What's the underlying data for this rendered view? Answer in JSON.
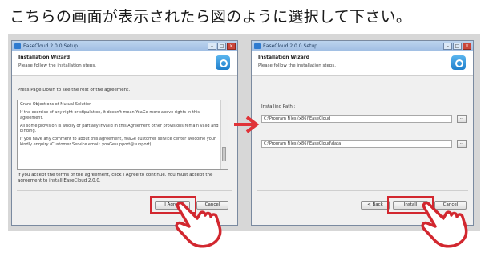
{
  "heading": "こちらの画面が表示されたら図のように選択して下さい。",
  "window1": {
    "title": "EaseCloud 2.0.0 Setup",
    "header_title": "Installation Wizard",
    "header_subtitle": "Please follow the installation steps.",
    "instruction": "Press Page Down to see the rest of the agreement.",
    "license_paragraphs": [
      "Grant Objections of Mutual Solution",
      "If the exercise of any right or stipulation, it doesn't mean YoaGe more above rights in this agreement.",
      "All some provision is wholly or partially invalid in this Agreement other provisions remain valid and binding.",
      "If you have any comment to about this agreement, YoaGe customer service center welcome your kindly enquiry (Customer Service email: yoaGesupport@support)"
    ],
    "accept_text": "If you accept the terms of the agreement, click I Agree to continue. You must accept the agreement to install EaseCloud 2.0.0.",
    "agree_button": "I Agree",
    "cancel_button": "Cancel"
  },
  "window2": {
    "title": "EaseCloud 2.0.0 Setup",
    "header_title": "Installation Wizard",
    "header_subtitle": "Please follow the installation steps.",
    "path_label": "Installing Path :",
    "path1": "C:\\Program Files (x86)\\EaseCloud",
    "path2": "C:\\Program Files (x86)\\EaseCloud\\data",
    "browse1": "...",
    "browse2": "...",
    "back_button": "< Back",
    "install_button": "Install",
    "cancel_button": "Cancel"
  },
  "window_controls": {
    "minimize": "–",
    "maximize": "□",
    "close": "×"
  },
  "colors": {
    "highlight": "#d2272f",
    "arrow": "#e03338",
    "titlebar": "#a9c6e8"
  },
  "icons": [
    "app-icon",
    "easecloud-logo-icon",
    "pointing-hand-icon",
    "right-arrow-icon"
  ]
}
